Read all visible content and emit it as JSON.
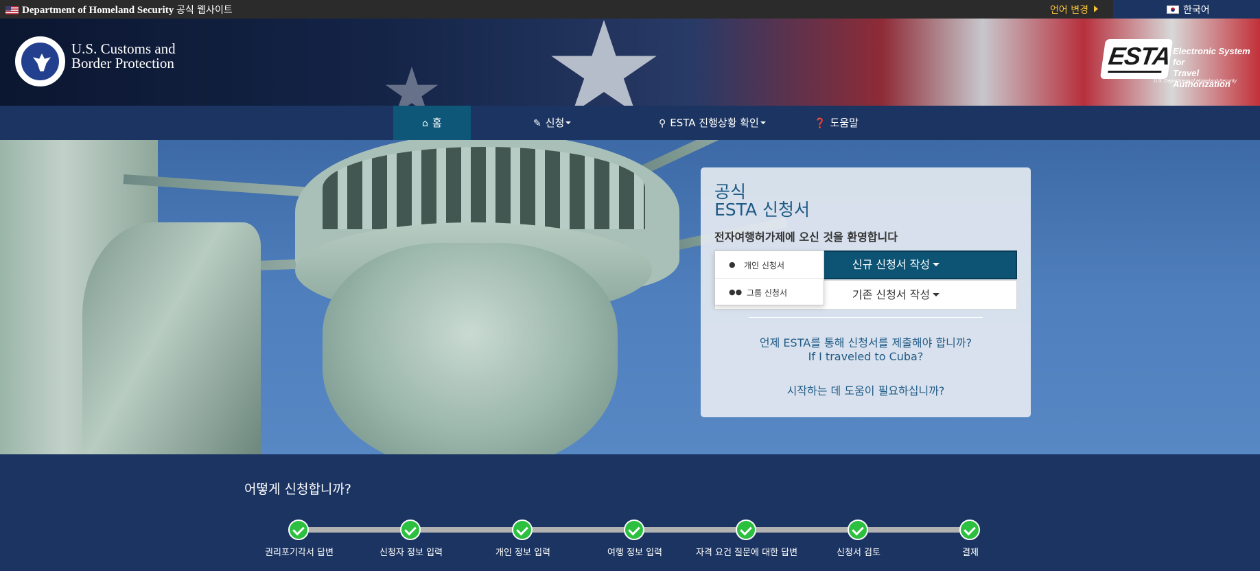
{
  "topbar": {
    "gov_label": "Department of Homeland Security",
    "gov_suffix": "공식 웹사이트",
    "language_change": "언어 변경",
    "current_language": "한국어"
  },
  "header": {
    "agency_line1": "U.S. Customs and",
    "agency_line2": "Border Protection",
    "esta_mark": "ESTA",
    "esta_sub1": "Electronic System for",
    "esta_sub2": "Travel Authorization",
    "esta_dept": "U.S. Department of Homeland Security"
  },
  "nav": {
    "items": [
      {
        "label": "홈",
        "icon": "home-icon",
        "active": true
      },
      {
        "label": "신청",
        "icon": "pencil-icon"
      },
      {
        "label": "ESTA 진행상황 확인",
        "icon": "search-icon"
      },
      {
        "label": "도움말",
        "icon": "help-icon"
      }
    ]
  },
  "card": {
    "title1": "공식",
    "title2": "ESTA 신청서",
    "welcome": "전자여행허가제에 오신 것을 환영합니다",
    "new_app": "신규 신청서 작성",
    "existing_app": "기존 신청서 작성",
    "link_when": "언제 ESTA를 통해 신청서를 제출해야 합니까?",
    "link_cuba": "If I traveled to Cuba?",
    "link_help": "시작하는 데 도움이 필요하십니까?"
  },
  "dropdown": {
    "options": [
      {
        "label": "개인 신청서",
        "icon": "user-icon"
      },
      {
        "label": "그룹 신청서",
        "icon": "users-icon"
      }
    ]
  },
  "how": {
    "title": "어떻게 신청합니까?",
    "steps": [
      {
        "label": "권리포기각서 답변"
      },
      {
        "label": "신청자 정보 입력"
      },
      {
        "label": "개인 정보 입력"
      },
      {
        "label": "여행 정보 입력"
      },
      {
        "label": "자격 요건 질문에 대한 답변"
      },
      {
        "label": "신청서 검토"
      },
      {
        "label": "결제"
      }
    ]
  },
  "colors": {
    "nav_bg": "#1b3461",
    "nav_active": "#0e5779",
    "primary_button": "#0c5374",
    "link": "#1f5a85",
    "step_check": "#2dbf3f",
    "lang_accent": "#f7c23c"
  }
}
